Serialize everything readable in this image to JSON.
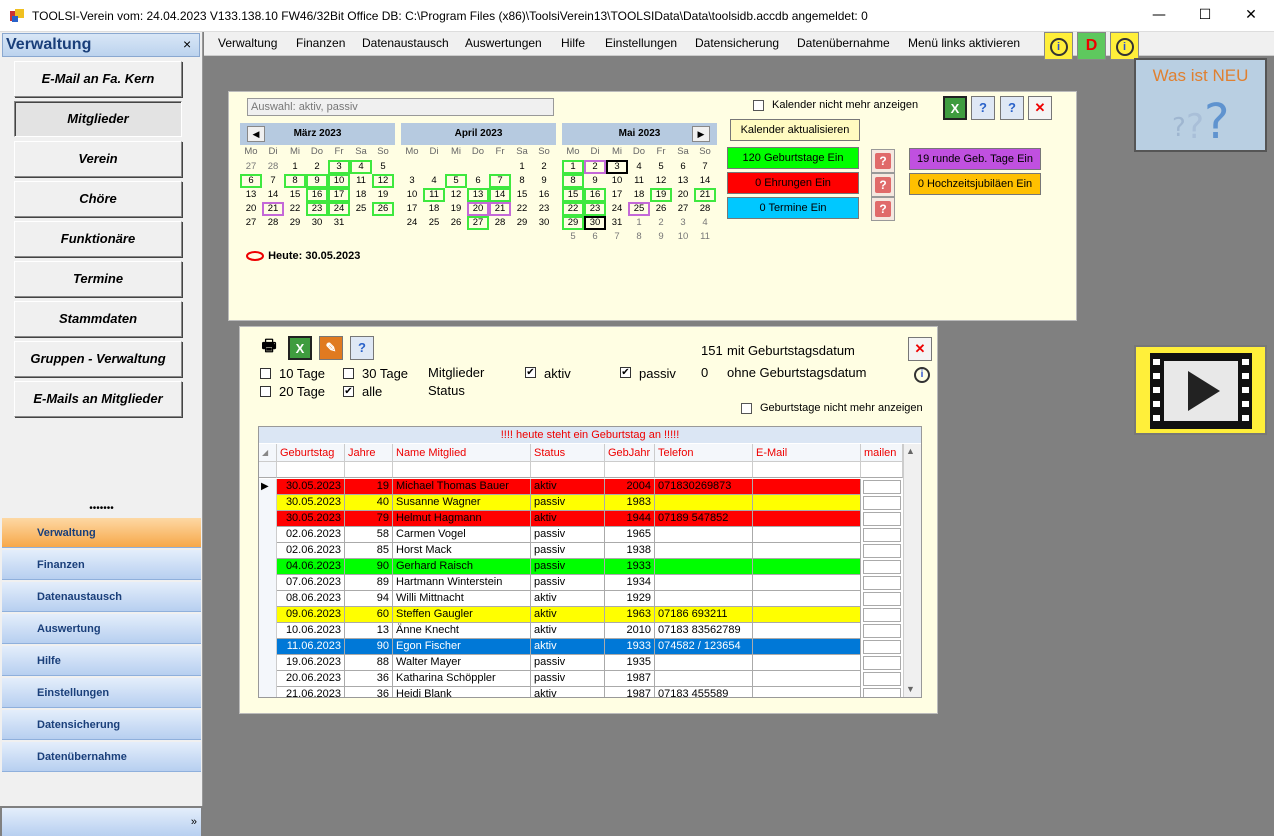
{
  "window": {
    "title": "TOOLSI-Verein  vom: 24.04.2023 V133.138.10 FW46/32Bit Office DB: C:\\Program Files (x86)\\ToolsiVerein13\\TOOLSIData\\Data\\toolsidb.accdb angemeldet: 0",
    "minimize": "—",
    "maximize": "☐",
    "close": "✕"
  },
  "sidebar": {
    "title": "Verwaltung",
    "close": "×",
    "buttons": [
      "E-Mail an Fa. Kern",
      "Mitglieder",
      "Verein",
      "Chöre",
      "Funktionäre",
      "Termine",
      "Stammdaten",
      "Gruppen - Verwaltung",
      "E-Mails an Mitglieder"
    ],
    "dots": "•••••••",
    "nav": [
      "Verwaltung",
      "Finanzen",
      "Datenaustausch",
      "Auswertung",
      "Hilfe",
      "Einstellungen",
      "Datensicherung",
      "Datenübernahme"
    ],
    "more": "»"
  },
  "menubar": {
    "items": [
      "Verwaltung",
      "Finanzen",
      "Datenaustausch",
      "Auswertungen",
      "Hilfe",
      "Einstellungen",
      "Datensicherung",
      "Datenübernahme",
      "Menü links aktivieren"
    ],
    "icon_d": "D",
    "icon_info": "i"
  },
  "whatsnew": {
    "label": "Was ist NEU"
  },
  "calendar_panel": {
    "filter_text": "Auswahl: aktiv, passiv",
    "hide_calendar_label": "Kalender nicht mehr anzeigen",
    "refresh_label": "Kalender aktualisieren",
    "today_label": "Heute: 30.05.2023",
    "dow": [
      "Mo",
      "Di",
      "Mi",
      "Do",
      "Fr",
      "Sa",
      "So"
    ],
    "months": [
      {
        "name": "März 2023",
        "days": [
          [
            "27",
            "o",
            ""
          ],
          [
            "28",
            "o",
            ""
          ],
          [
            "1",
            "",
            ""
          ],
          [
            "2",
            "",
            ""
          ],
          [
            "3",
            "",
            "g"
          ],
          [
            "4",
            "",
            "g"
          ],
          [
            "5",
            "",
            ""
          ],
          [
            "6",
            "",
            "g"
          ],
          [
            "7",
            "",
            ""
          ],
          [
            "8",
            "",
            "g"
          ],
          [
            "9",
            "",
            "g"
          ],
          [
            "10",
            "",
            "g"
          ],
          [
            "11",
            "",
            ""
          ],
          [
            "12",
            "",
            "g"
          ],
          [
            "13",
            "",
            ""
          ],
          [
            "14",
            "",
            ""
          ],
          [
            "15",
            "",
            ""
          ],
          [
            "16",
            "",
            "g"
          ],
          [
            "17",
            "",
            "g"
          ],
          [
            "18",
            "",
            ""
          ],
          [
            "19",
            "",
            ""
          ],
          [
            "20",
            "",
            ""
          ],
          [
            "21",
            "",
            "p"
          ],
          [
            "22",
            "",
            ""
          ],
          [
            "23",
            "",
            "g"
          ],
          [
            "24",
            "",
            "g"
          ],
          [
            "25",
            "",
            ""
          ],
          [
            "26",
            "",
            "g"
          ],
          [
            "27",
            "",
            ""
          ],
          [
            "28",
            "",
            ""
          ],
          [
            "29",
            "",
            ""
          ],
          [
            "30",
            "",
            ""
          ],
          [
            "31",
            "",
            ""
          ]
        ]
      },
      {
        "name": "April 2023",
        "days": [
          [
            "",
            "",
            ""
          ],
          [
            "",
            "",
            ""
          ],
          [
            "",
            "",
            ""
          ],
          [
            "",
            "",
            ""
          ],
          [
            "",
            "",
            ""
          ],
          [
            "1",
            "",
            ""
          ],
          [
            "2",
            "",
            ""
          ],
          [
            "3",
            "",
            ""
          ],
          [
            "4",
            "",
            ""
          ],
          [
            "5",
            "",
            "g"
          ],
          [
            "6",
            "",
            ""
          ],
          [
            "7",
            "",
            "g"
          ],
          [
            "8",
            "",
            ""
          ],
          [
            "9",
            "",
            ""
          ],
          [
            "10",
            "",
            ""
          ],
          [
            "11",
            "",
            "g"
          ],
          [
            "12",
            "",
            ""
          ],
          [
            "13",
            "",
            "g"
          ],
          [
            "14",
            "",
            "g"
          ],
          [
            "15",
            "",
            ""
          ],
          [
            "16",
            "",
            ""
          ],
          [
            "17",
            "",
            ""
          ],
          [
            "18",
            "",
            ""
          ],
          [
            "19",
            "",
            ""
          ],
          [
            "20",
            "",
            "p"
          ],
          [
            "21",
            "",
            "p"
          ],
          [
            "22",
            "",
            ""
          ],
          [
            "23",
            "",
            ""
          ],
          [
            "24",
            "",
            ""
          ],
          [
            "25",
            "",
            ""
          ],
          [
            "26",
            "",
            ""
          ],
          [
            "27",
            "",
            "g"
          ],
          [
            "28",
            "",
            ""
          ],
          [
            "29",
            "",
            ""
          ],
          [
            "30",
            "",
            ""
          ]
        ]
      },
      {
        "name": "Mai 2023",
        "days": [
          [
            "1",
            "",
            "g"
          ],
          [
            "2",
            "",
            "p"
          ],
          [
            "3",
            "",
            "b"
          ],
          [
            "4",
            "",
            ""
          ],
          [
            "5",
            "",
            ""
          ],
          [
            "6",
            "",
            ""
          ],
          [
            "7",
            "",
            ""
          ],
          [
            "8",
            "",
            "g"
          ],
          [
            "9",
            "",
            ""
          ],
          [
            "10",
            "",
            ""
          ],
          [
            "11",
            "",
            ""
          ],
          [
            "12",
            "",
            ""
          ],
          [
            "13",
            "",
            ""
          ],
          [
            "14",
            "",
            ""
          ],
          [
            "15",
            "",
            "g"
          ],
          [
            "16",
            "",
            "g"
          ],
          [
            "17",
            "",
            ""
          ],
          [
            "18",
            "",
            ""
          ],
          [
            "19",
            "",
            "g"
          ],
          [
            "20",
            "",
            ""
          ],
          [
            "21",
            "",
            "g"
          ],
          [
            "22",
            "",
            "g"
          ],
          [
            "23",
            "",
            "g"
          ],
          [
            "24",
            "",
            ""
          ],
          [
            "25",
            "",
            "p"
          ],
          [
            "26",
            "",
            ""
          ],
          [
            "27",
            "",
            ""
          ],
          [
            "28",
            "",
            ""
          ],
          [
            "29",
            "",
            "g"
          ],
          [
            "30",
            "",
            "b"
          ],
          [
            "31",
            "",
            ""
          ],
          [
            "1",
            "o",
            ""
          ],
          [
            "2",
            "o",
            ""
          ],
          [
            "3",
            "o",
            ""
          ],
          [
            "4",
            "o",
            ""
          ],
          [
            "5",
            "o",
            ""
          ],
          [
            "6",
            "o",
            ""
          ],
          [
            "7",
            "o",
            ""
          ],
          [
            "8",
            "o",
            ""
          ],
          [
            "9",
            "o",
            ""
          ],
          [
            "10",
            "o",
            ""
          ],
          [
            "11",
            "o",
            ""
          ]
        ]
      }
    ],
    "nav_prev": "◀",
    "nav_next": "▶",
    "btn_birthdays": "120 Geburtstage Ein",
    "btn_honors": "0 Ehrungen Ein",
    "btn_dates": "0 Termine Ein",
    "btn_round": "19 runde Geb. Tage Ein",
    "btn_wedding": "0 Hochzeitsjubiläen Ein",
    "q": "?",
    "colors": {
      "green": "#00ff00",
      "red": "#ff0000",
      "cyan": "#00c8ff",
      "purple": "#c050e0",
      "orange": "#ffc000"
    }
  },
  "birthday_panel": {
    "opt_10": "10 Tage",
    "opt_30": "30 Tage",
    "opt_20": "20 Tage",
    "opt_all": "alle",
    "status_label": "Mitglieder Status",
    "aktiv": "aktiv",
    "passiv": "passiv",
    "with_date_count": "151",
    "with_date_label": "mit Geburtstagsdatum",
    "without_date_count": "0",
    "without_date_label": "ohne Geburtstagsdatum",
    "hide_label": "Geburtstage nicht mehr anzeigen",
    "check": "✔",
    "grid_title": "!!!! heute steht ein Geburtstag an !!!!!",
    "columns": [
      "Geburtstag",
      "Jahre",
      "Name Mitglied",
      "Status",
      "GebJahr",
      "Telefon",
      "E-Mail",
      "mailen"
    ],
    "rows": [
      {
        "date": "30.05.2023",
        "age": "19",
        "name": "Michael Thomas Bauer",
        "status": "aktiv",
        "year": "2004",
        "phone": "071830269873",
        "bg": "#ff0000",
        "fg": "#000"
      },
      {
        "date": "30.05.2023",
        "age": "40",
        "name": "Susanne Wagner",
        "status": "passiv",
        "year": "1983",
        "phone": "",
        "bg": "#ffff00",
        "fg": "#000"
      },
      {
        "date": "30.05.2023",
        "age": "79",
        "name": "Helmut Hagmann",
        "status": "aktiv",
        "year": "1944",
        "phone": "07189 547852",
        "bg": "#ff0000",
        "fg": "#000"
      },
      {
        "date": "02.06.2023",
        "age": "58",
        "name": "Carmen Vogel",
        "status": "passiv",
        "year": "1965",
        "phone": "",
        "bg": "#ffffff",
        "fg": "#000"
      },
      {
        "date": "02.06.2023",
        "age": "85",
        "name": "Horst Mack",
        "status": "passiv",
        "year": "1938",
        "phone": "",
        "bg": "#ffffff",
        "fg": "#000"
      },
      {
        "date": "04.06.2023",
        "age": "90",
        "name": "Gerhard Raisch",
        "status": "passiv",
        "year": "1933",
        "phone": "",
        "bg": "#00ff00",
        "fg": "#000"
      },
      {
        "date": "07.06.2023",
        "age": "89",
        "name": "Hartmann Winterstein",
        "status": "passiv",
        "year": "1934",
        "phone": "",
        "bg": "#ffffff",
        "fg": "#000"
      },
      {
        "date": "08.06.2023",
        "age": "94",
        "name": "Willi Mittnacht",
        "status": "aktiv",
        "year": "1929",
        "phone": "",
        "bg": "#ffffff",
        "fg": "#000"
      },
      {
        "date": "09.06.2023",
        "age": "60",
        "name": "Steffen Gaugler",
        "status": "aktiv",
        "year": "1963",
        "phone": "07186 693211",
        "bg": "#ffff00",
        "fg": "#000"
      },
      {
        "date": "10.06.2023",
        "age": "13",
        "name": "Änne Knecht",
        "status": "aktiv",
        "year": "2010",
        "phone": "07183 83562789",
        "bg": "#ffffff",
        "fg": "#000"
      },
      {
        "date": "11.06.2023",
        "age": "90",
        "name": "Egon Fischer",
        "status": "aktiv",
        "year": "1933",
        "phone": "074582 / 123654",
        "bg": "#0078d7",
        "fg": "#fff"
      },
      {
        "date": "19.06.2023",
        "age": "88",
        "name": "Walter Mayer",
        "status": "passiv",
        "year": "1935",
        "phone": "",
        "bg": "#ffffff",
        "fg": "#000"
      },
      {
        "date": "20.06.2023",
        "age": "36",
        "name": "Katharina Schöppler",
        "status": "passiv",
        "year": "1987",
        "phone": "",
        "bg": "#ffffff",
        "fg": "#000"
      },
      {
        "date": "21.06.2023",
        "age": "36",
        "name": "Heidi Blank",
        "status": "aktiv",
        "year": "1987",
        "phone": "07183 455589",
        "bg": "#ffffff",
        "fg": "#000"
      }
    ],
    "row_pointer": "▶",
    "scroll_up": "▲",
    "scroll_down": "▼"
  },
  "video_button": {
    "icon": "play-icon"
  }
}
